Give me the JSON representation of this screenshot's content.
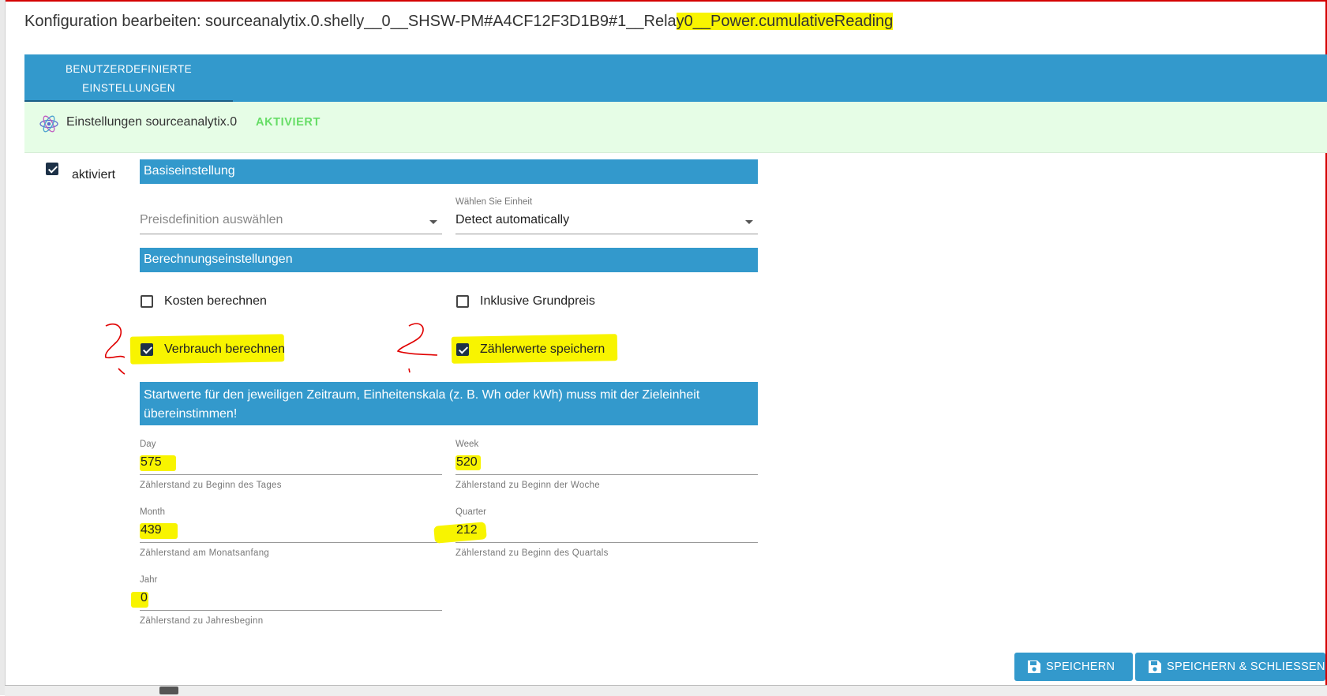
{
  "dialog": {
    "title_prefix": "Konfiguration bearbeiten: sourceanalytix.0.shelly__0__SHSW-PM#A4CF12F3D1B9#1__Rela",
    "title_highlight": "y0__Power.cumulativeReading"
  },
  "tabs": [
    {
      "label_line1": "BENUTZERDEFINIERTE",
      "label_line2": "EINSTELLUNGEN"
    }
  ],
  "adapter": {
    "settings_label": "Einstellungen sourceanalytix.0",
    "status": "AKTIVIERT"
  },
  "enabled": {
    "label": "aktiviert",
    "checked": true
  },
  "sections": {
    "basic": "Basiseinstellung",
    "calculation": "Berechnungseinstellungen",
    "start_values": "Startwerte für den jeweiligen Zeitraum, Einheitenskala (z. B. Wh oder kWh) muss mit der Zieleinheit übereinstimmen!"
  },
  "price_select": {
    "placeholder": "Preisdefinition auswählen"
  },
  "unit_select": {
    "label": "Wählen Sie Einheit",
    "value": "Detect automatically"
  },
  "options": {
    "calc_costs": {
      "label": "Kosten berechnen",
      "checked": false
    },
    "include_base_price": {
      "label": "Inklusive Grundpreis",
      "checked": false
    },
    "calc_consumption": {
      "label": "Verbrauch berechnen",
      "checked": true
    },
    "save_meter_values": {
      "label": "Zählerwerte speichern",
      "checked": true
    }
  },
  "start_fields": {
    "day": {
      "label": "Day",
      "value": "575",
      "helper": "Zählerstand zu Beginn des Tages"
    },
    "week": {
      "label": "Week",
      "value": "520",
      "helper": "Zählerstand zu Beginn der Woche"
    },
    "month": {
      "label": "Month",
      "value": "439",
      "helper": "Zählerstand am Monatsanfang"
    },
    "quarter": {
      "label": "Quarter",
      "value": "212",
      "helper": "Zählerstand zu Beginn des Quartals"
    },
    "year": {
      "label": "Jahr",
      "value": "0",
      "helper": "Zählerstand zu Jahresbeginn"
    }
  },
  "buttons": {
    "save": "SPEICHERN",
    "save_close": "SPEICHERN & SCHLIESSEN"
  },
  "colors": {
    "primary": "#3399cc",
    "active_bg": "#e6fde6",
    "active_text": "#66dd66",
    "highlight": "#f8f400",
    "checkbox": "#1d3147",
    "annotation": "#e00000"
  }
}
